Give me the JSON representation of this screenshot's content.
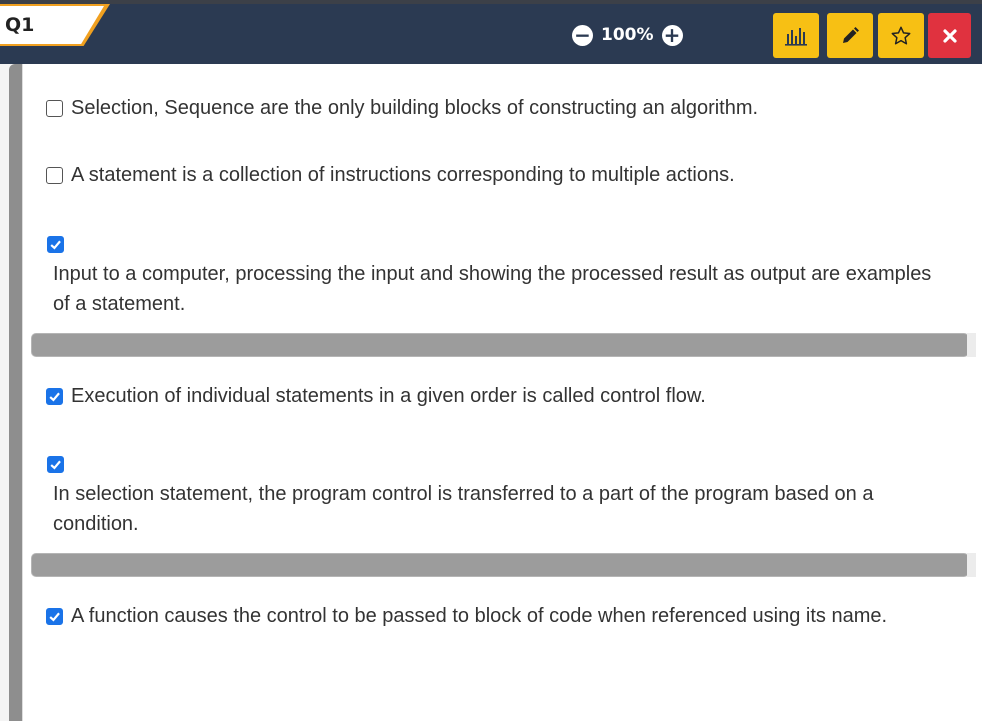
{
  "toolbar": {
    "question_label": "Q1",
    "zoom_level": "100%",
    "colors": {
      "bar": "#2b3a52",
      "accent": "#f7c014",
      "close": "#e0323f"
    },
    "buttons": [
      {
        "name": "statistics",
        "icon": "bar-chart-icon"
      },
      {
        "name": "edit",
        "icon": "pencil-icon"
      },
      {
        "name": "favorite",
        "icon": "star-icon"
      },
      {
        "name": "close",
        "icon": "close-icon"
      }
    ]
  },
  "options": [
    {
      "text": "Selection, Sequence are the only building blocks of constructing an algorithm.",
      "checked": false
    },
    {
      "text": "A statement is a collection of instructions corresponding to multiple actions.",
      "checked": false
    },
    {
      "text": "Input to a computer, processing the input and showing the processed result as output are examples of a statement.",
      "checked": true
    },
    {
      "text": "Execution of individual statements in a given order is called control flow.",
      "checked": true
    },
    {
      "text": "In selection statement, the program control is transferred to a part of the program based on a condition.",
      "checked": true
    },
    {
      "text": "A function causes the control to be passed to block of code when referenced using its name.",
      "checked": true
    }
  ]
}
